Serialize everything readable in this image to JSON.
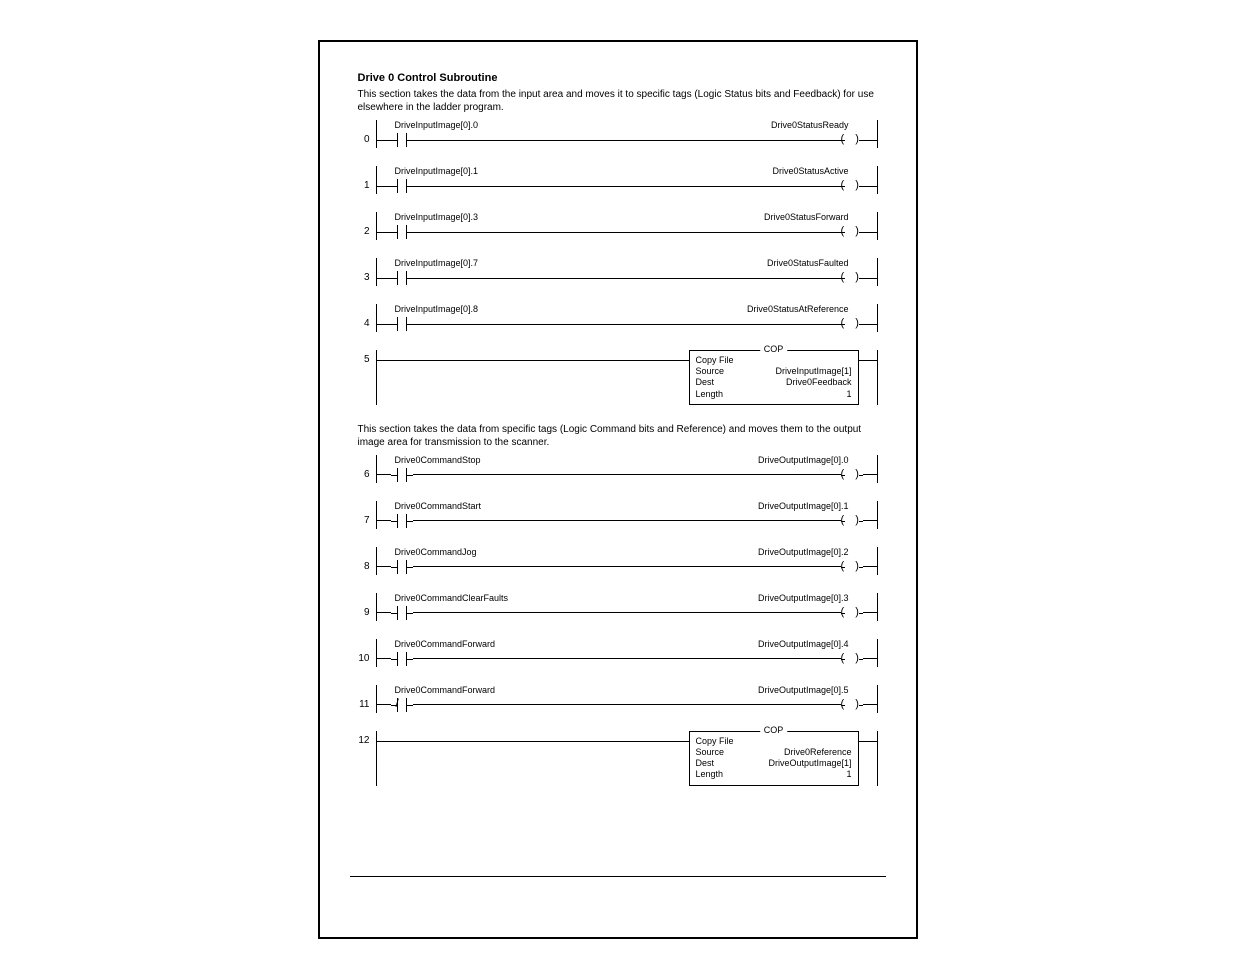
{
  "title": "Drive 0 Control Subroutine",
  "desc1": "This section takes the data from the input area and moves it to specific tags (Logic Status bits and Feedback) for use elsewhere in the ladder program.",
  "desc2": "This section takes the data from specific tags (Logic Command bits and Reference) and moves them to the output image area for transmission to the scanner.",
  "rungs": [
    {
      "n": "0",
      "type": "xic",
      "left": "DriveInputImage[0].0",
      "right": "Drive0StatusReady"
    },
    {
      "n": "1",
      "type": "xic",
      "left": "DriveInputImage[0].1",
      "right": "Drive0StatusActive"
    },
    {
      "n": "2",
      "type": "xic",
      "left": "DriveInputImage[0].3",
      "right": "Drive0StatusForward"
    },
    {
      "n": "3",
      "type": "xic",
      "left": "DriveInputImage[0].7",
      "right": "Drive0StatusFaulted"
    },
    {
      "n": "4",
      "type": "xic",
      "left": "DriveInputImage[0].8",
      "right": "Drive0StatusAtReference"
    },
    {
      "n": "5",
      "type": "cop",
      "name": "COP",
      "head": "Copy File",
      "rows": [
        {
          "k": "Source",
          "v": "DriveInputImage[1]"
        },
        {
          "k": "Dest",
          "v": "Drive0Feedback"
        },
        {
          "k": "Length",
          "v": "1"
        }
      ]
    },
    {
      "n": "6",
      "type": "xic",
      "left": "Drive0CommandStop",
      "right": "DriveOutputImage[0].0"
    },
    {
      "n": "7",
      "type": "xic",
      "left": "Drive0CommandStart",
      "right": "DriveOutputImage[0].1"
    },
    {
      "n": "8",
      "type": "xic",
      "left": "Drive0CommandJog",
      "right": "DriveOutputImage[0].2"
    },
    {
      "n": "9",
      "type": "xic",
      "left": "Drive0CommandClearFaults",
      "right": "DriveOutputImage[0].3"
    },
    {
      "n": "10",
      "type": "xic",
      "left": "Drive0CommandForward",
      "right": "DriveOutputImage[0].4"
    },
    {
      "n": "11",
      "type": "xio",
      "left": "Drive0CommandForward",
      "right": "DriveOutputImage[0].5"
    },
    {
      "n": "12",
      "type": "cop",
      "name": "COP",
      "head": "Copy File",
      "rows": [
        {
          "k": "Source",
          "v": "Drive0Reference"
        },
        {
          "k": "Dest",
          "v": "DriveOutputImage[1]"
        },
        {
          "k": "Length",
          "v": "1"
        }
      ]
    }
  ]
}
